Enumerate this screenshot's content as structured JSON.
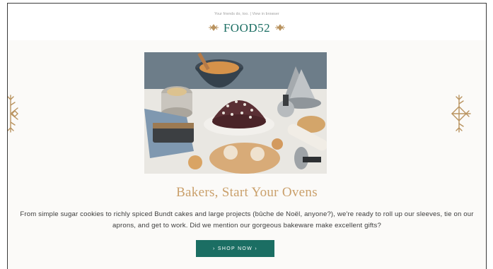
{
  "header": {
    "preheader": "Your friends do, too. | View in browser",
    "logo_text": "FOOD52"
  },
  "hero": {
    "title": "Bakers, Start Your Ovens",
    "body": "From simple sugar cookies to richly spiced Bundt cakes and large projects (bûche de Noël, anyone?), we're ready to roll up our sleeves, tie on our aprons, and get to work. Did we mention our gorgeous bakeware make excellent gifts?",
    "cta_label": "› SHOP NOW ›"
  },
  "colors": {
    "brand_teal": "#1b6e63",
    "title_gold": "#caa06b",
    "deco_gold": "#b9935f",
    "content_bg": "#fbfaf8"
  },
  "icons": {
    "left_ornament": "snowflake-ornament-icon",
    "right_ornament": "snowflake-ornament-icon",
    "logo_ornament": "leaf-ornament-icon"
  }
}
